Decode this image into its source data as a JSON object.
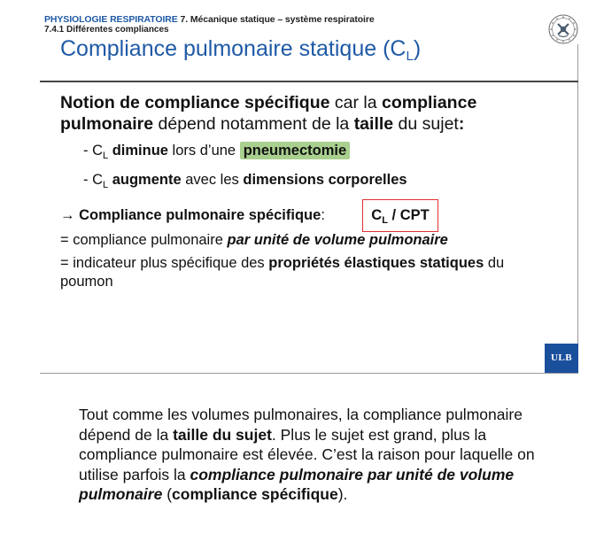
{
  "header": {
    "section_label": "PHYSIOLOGIE RESPIRATOIRE",
    "chapter_label": "7. Mécanique statique – système respiratoire",
    "subsection_label": "7.4.1 Différentes compliances",
    "seal_icon": "university-seal-icon"
  },
  "slide": {
    "title_main": "Compliance pulmonaire statique (C",
    "title_sub": "L",
    "title_end": ")",
    "intro": {
      "p1_bold": "Notion de compliance spécifique",
      "p1_text": " car la ",
      "p2_bold": "compliance pulmonaire",
      "p2_text": " dépend notamment de la ",
      "p3_bold": "taille",
      "p3_text": " du sujet",
      "p3_colon": ":"
    },
    "bullets": [
      {
        "dash": "- C",
        "sub": "L",
        "bold": " diminue",
        "text": " lors d’une ",
        "highlight": "pneumectomie"
      },
      {
        "dash": "- C",
        "sub": "L",
        "bold": " augmente",
        "text": " avec les ",
        "bold2": "dimensions corporelles"
      }
    ],
    "specific": {
      "arrow": "→",
      "label": " Compliance pulmonaire spécifique",
      "colon": ":",
      "box_c": "C",
      "box_sub": "L",
      "box_rest": " / CPT"
    },
    "eq1": {
      "prefix": "= compliance pulmonaire ",
      "bold_italic": "par unité de volume pulmonaire"
    },
    "eq2": {
      "prefix": "= indicateur plus spécifique des ",
      "bold": "propriétés élastiques statiques",
      "suffix": " du poumon"
    },
    "logo_text": "ULB",
    "accent_color": "#1f5aa6",
    "highlight_color": "#a9d08e",
    "box_border_color": "#e03030"
  },
  "notes": {
    "t1": "Tout comme les volumes pulmonaires, la compliance pulmonaire dépend de la ",
    "b1": "taille du sujet",
    "t2": ". Plus le sujet est grand, plus la compliance pulmonaire est élevée. C’est la raison pour laquelle on utilise parfois la ",
    "bi1": "compliance pulmonaire par unité de volume pulmonaire",
    "t3": " (",
    "b2": "compliance spécifique",
    "t4": ")."
  }
}
